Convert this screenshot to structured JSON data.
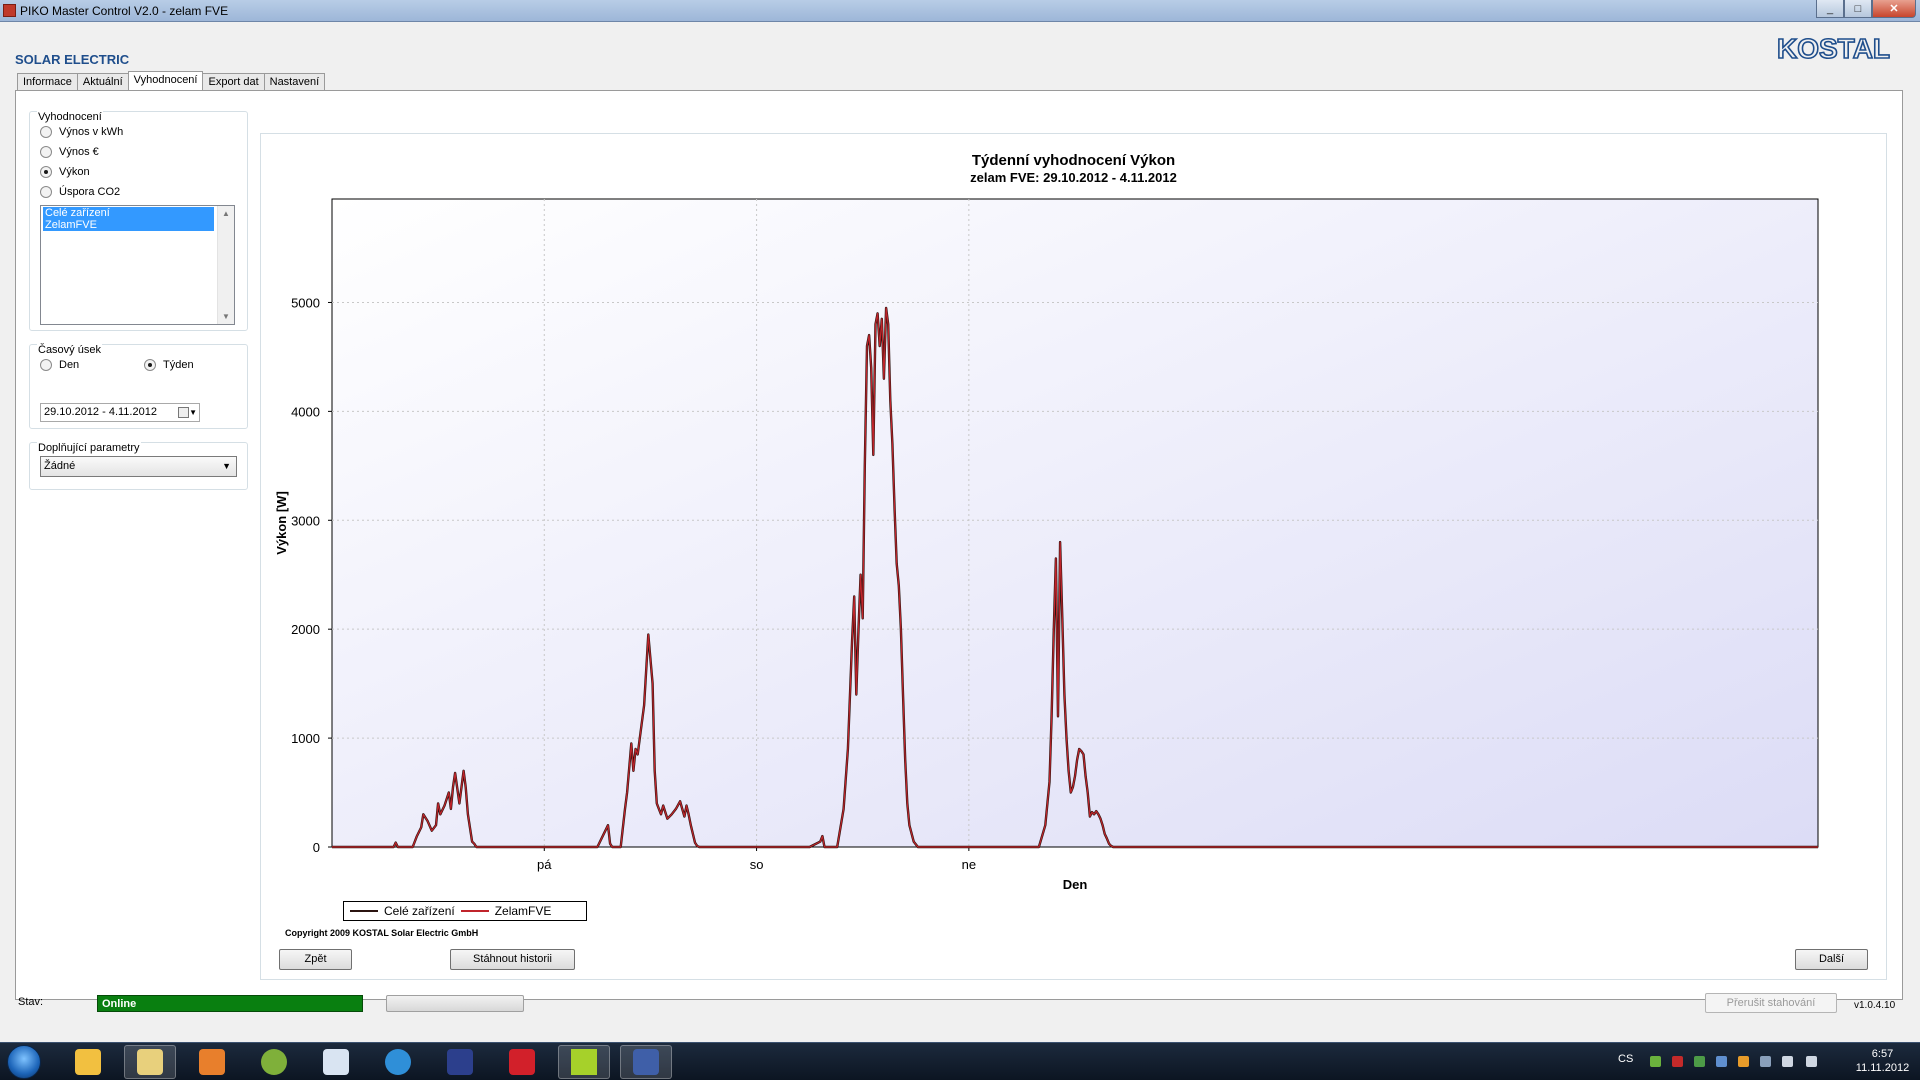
{
  "window": {
    "title": "PIKO Master Control V2.0 - zelam FVE",
    "min": "_",
    "max": "□",
    "close": "✕"
  },
  "brand": "SOLAR ELECTRIC",
  "logo_text": "KOSTAL",
  "tabs": [
    {
      "label": "Informace"
    },
    {
      "label": "Aktuální"
    },
    {
      "label": "Vyhodnocení"
    },
    {
      "label": "Export dat"
    },
    {
      "label": "Nastavení"
    }
  ],
  "active_tab": "Vyhodnocení",
  "evaluation": {
    "legend": "Vyhodnocení",
    "options": [
      {
        "label": "Výnos v kWh",
        "checked": false
      },
      {
        "label": "Výnos €",
        "checked": false
      },
      {
        "label": "Výkon",
        "checked": true
      },
      {
        "label": "Úspora CO2",
        "checked": false
      }
    ],
    "devices": [
      "Celé zařízení",
      "ZelamFVE"
    ]
  },
  "period": {
    "legend": "Časový úsek",
    "day_label": "Den",
    "week_label": "Týden",
    "selected": "Týden",
    "date_range": "29.10.2012 - 4.11.2012"
  },
  "extra": {
    "legend": "Doplňující parametry",
    "value": "Žádné"
  },
  "chart_data": {
    "type": "line",
    "title": "Týdenní vyhodnocení Výkon",
    "subtitle": "zelam FVE: 29.10.2012 - 4.11.2012",
    "xlabel": "Den",
    "ylabel": "Výkon [W]",
    "ylim": [
      0,
      5950
    ],
    "yticks": [
      0,
      1000,
      2000,
      3000,
      4000,
      5000
    ],
    "xlim": [
      0,
      7
    ],
    "xticks": [
      {
        "pos": 1,
        "label": "pá"
      },
      {
        "pos": 2,
        "label": "so"
      },
      {
        "pos": 3,
        "label": "ne"
      }
    ],
    "grid": true,
    "legend_position": "bottom-left",
    "x": [
      0,
      0.29,
      0.3,
      0.31,
      0.38,
      0.4,
      0.42,
      0.43,
      0.45,
      0.47,
      0.49,
      0.5,
      0.51,
      0.53,
      0.55,
      0.56,
      0.57,
      0.58,
      0.6,
      0.62,
      0.63,
      0.64,
      0.66,
      0.67,
      0.68,
      0.69,
      0.7,
      0.72,
      0.73,
      0.75,
      0.78,
      0.85,
      1.05,
      1.25,
      1.3,
      1.31,
      1.32,
      1.33,
      1.36,
      1.38,
      1.39,
      1.41,
      1.42,
      1.43,
      1.44,
      1.45,
      1.47,
      1.49,
      1.51,
      1.52,
      1.53,
      1.54,
      1.55,
      1.56,
      1.58,
      1.6,
      1.62,
      1.64,
      1.66,
      1.67,
      1.68,
      1.69,
      1.7,
      1.71,
      1.72,
      1.73,
      1.74,
      1.76,
      1.78,
      1.85,
      2.05,
      2.25,
      2.3,
      2.31,
      2.32,
      2.33,
      2.38,
      2.41,
      2.43,
      2.45,
      2.46,
      2.47,
      2.48,
      2.49,
      2.5,
      2.51,
      2.52,
      2.53,
      2.54,
      2.55,
      2.56,
      2.57,
      2.58,
      2.59,
      2.6,
      2.61,
      2.62,
      2.63,
      2.64,
      2.65,
      2.66,
      2.67,
      2.68,
      2.69,
      2.7,
      2.71,
      2.72,
      2.74,
      2.76,
      2.78,
      2.81,
      2.85,
      2.92,
      3.05,
      3.25,
      3.33,
      3.36,
      3.38,
      3.39,
      3.4,
      3.41,
      3.42,
      3.43,
      3.44,
      3.45,
      3.46,
      3.47,
      3.48,
      3.49,
      3.5,
      3.51,
      3.52,
      3.53,
      3.54,
      3.55,
      3.56,
      3.57,
      3.58,
      3.59,
      3.6,
      3.61,
      3.62,
      3.63,
      3.64,
      3.65,
      3.66,
      3.67,
      3.68,
      3.69,
      3.7,
      3.71,
      3.72,
      3.73,
      3.74,
      3.76,
      3.78,
      3.85,
      4.05,
      4.5,
      5.0,
      5.5,
      6.0,
      6.5,
      7.0
    ],
    "series": [
      {
        "name": "Celé zařízení",
        "color": "#2b1410",
        "values": [
          0,
          0,
          40,
          0,
          0,
          100,
          180,
          300,
          240,
          150,
          200,
          400,
          300,
          380,
          500,
          350,
          550,
          680,
          400,
          700,
          550,
          300,
          50,
          30,
          0,
          0,
          0,
          0,
          0,
          0,
          0,
          0,
          0,
          0,
          200,
          30,
          0,
          0,
          0,
          350,
          500,
          950,
          700,
          900,
          850,
          1000,
          1300,
          1950,
          1500,
          700,
          400,
          350,
          300,
          380,
          260,
          300,
          350,
          420,
          280,
          380,
          300,
          200,
          120,
          40,
          10,
          0,
          0,
          0,
          0,
          0,
          0,
          0,
          50,
          100,
          0,
          0,
          0,
          350,
          900,
          1900,
          2300,
          1400,
          2000,
          2500,
          2100,
          3500,
          4600,
          4700,
          4400,
          3600,
          4800,
          4900,
          4600,
          4850,
          4300,
          4950,
          4800,
          4100,
          3700,
          3100,
          2600,
          2400,
          2000,
          1400,
          800,
          400,
          200,
          50,
          0,
          0,
          0,
          0,
          0,
          0,
          0,
          0,
          200,
          600,
          1200,
          2000,
          2650,
          1200,
          2800,
          2100,
          1400,
          1000,
          700,
          500,
          550,
          650,
          800,
          900,
          880,
          850,
          650,
          500,
          280,
          320,
          300,
          330,
          300,
          260,
          200,
          120,
          80,
          30,
          10,
          0,
          0,
          0,
          0,
          0,
          0,
          0,
          0,
          0,
          0,
          0,
          0,
          0,
          0,
          0,
          0,
          0
        ]
      },
      {
        "name": "ZelamFVE",
        "color": "#c0242b",
        "values": [
          0,
          0,
          40,
          0,
          0,
          100,
          180,
          300,
          240,
          150,
          200,
          400,
          300,
          380,
          500,
          350,
          550,
          680,
          400,
          700,
          550,
          300,
          50,
          30,
          0,
          0,
          0,
          0,
          0,
          0,
          0,
          0,
          0,
          0,
          200,
          30,
          0,
          0,
          0,
          350,
          500,
          950,
          700,
          900,
          850,
          1000,
          1300,
          1950,
          1500,
          700,
          400,
          350,
          300,
          380,
          260,
          300,
          350,
          420,
          280,
          380,
          300,
          200,
          120,
          40,
          10,
          0,
          0,
          0,
          0,
          0,
          0,
          0,
          50,
          100,
          0,
          0,
          0,
          350,
          900,
          1900,
          2300,
          1400,
          2000,
          2500,
          2100,
          3500,
          4600,
          4700,
          4400,
          3600,
          4800,
          4900,
          4600,
          4850,
          4300,
          4950,
          4800,
          4100,
          3700,
          3100,
          2600,
          2400,
          2000,
          1400,
          800,
          400,
          200,
          50,
          0,
          0,
          0,
          0,
          0,
          0,
          0,
          0,
          200,
          600,
          1200,
          2000,
          2650,
          1200,
          2800,
          2100,
          1400,
          1000,
          700,
          500,
          550,
          650,
          800,
          900,
          880,
          850,
          650,
          500,
          280,
          320,
          300,
          330,
          300,
          260,
          200,
          120,
          80,
          30,
          10,
          0,
          0,
          0,
          0,
          0,
          0,
          0,
          0,
          0,
          0,
          0,
          0,
          0,
          0,
          0,
          0,
          0
        ]
      }
    ]
  },
  "legend": {
    "item1": "Celé zařízení",
    "item2": "ZelamFVE"
  },
  "copyright": "Copyright 2009 KOSTAL Solar Electric GmbH",
  "buttons": {
    "back": "Zpět",
    "download": "Stáhnout historii",
    "next": "Další"
  },
  "status": {
    "label": "Stav:",
    "value": "Online",
    "stop": "Přerušit stahování",
    "version": "v1.0.4.10"
  },
  "taskbar": {
    "lang": "CS",
    "time": "6:57",
    "date": "11.11.2012"
  },
  "colors": {
    "online": "#097f10",
    "accent": "#1f4e8c",
    "logo": "#1f4e8c"
  }
}
